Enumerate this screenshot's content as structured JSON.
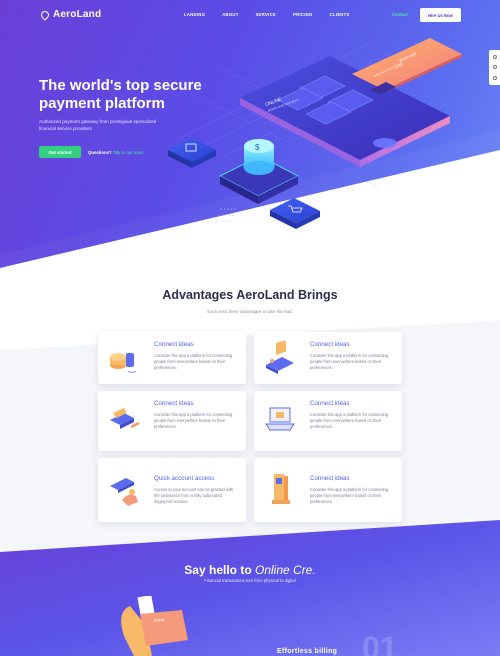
{
  "nav": {
    "logo": "AeroLand",
    "menu": [
      "LANDING",
      "ABOUT",
      "SERVICE",
      "PRICING",
      "CLIENTS"
    ],
    "link": "Contact",
    "cta": "Hire Us Now"
  },
  "hero": {
    "title": "The world's top secure payment platform",
    "subtitle": "Authorized payment gateway from prestigious specialized financial service providers",
    "primary_button": "Get started",
    "questions": "Questions?",
    "questions_link": "Talk to our team",
    "illustration": {
      "screen_label": "ONLINE",
      "screen_sublabel": "AEROLAND PAYMENT",
      "card_label": "Bank card",
      "card_number": "**** **** **** 3245"
    }
  },
  "advantages": {
    "title": "Advantages AeroLand Brings",
    "subtitle": "Each need these advantages to take the lead.",
    "cards": [
      {
        "title": "Connect ideas",
        "text": "Consider this app a platform for connecting people from everywhere based on their preferences.",
        "icon": "coins-icon"
      },
      {
        "title": "Connect ideas",
        "text": "Consider this app a platform for connecting people from everywhere based on their preferences.",
        "icon": "payment-terminal-icon"
      },
      {
        "title": "Connect ideas",
        "text": "Consider this app a platform for connecting people from everywhere based on their preferences.",
        "icon": "card-reader-icon"
      },
      {
        "title": "Connect ideas",
        "text": "Consider this app a platform for connecting people from everywhere based on their preferences.",
        "icon": "laptop-icon"
      },
      {
        "title": "Quick account access",
        "text": "Access to your account can be granted with the assistance from a fully automated fingerprint scanner.",
        "icon": "fingerprint-hand-icon"
      },
      {
        "title": "Connect ideas",
        "text": "Consider this app a platform for connecting people from everywhere based on their preferences.",
        "icon": "atm-icon"
      }
    ]
  },
  "hello": {
    "title_prefix": "Say hello to",
    "title_italic": "Online Cre.",
    "subtitle": "Financial transactions turn from physical to digital",
    "bank_label": "BANK",
    "heading": "Effortless billing",
    "number": "01"
  },
  "colors": {
    "accent": "#5360f0",
    "green": "#35d07f",
    "hero_start": "#6a3fd8",
    "hero_end": "#6f8cf7"
  }
}
